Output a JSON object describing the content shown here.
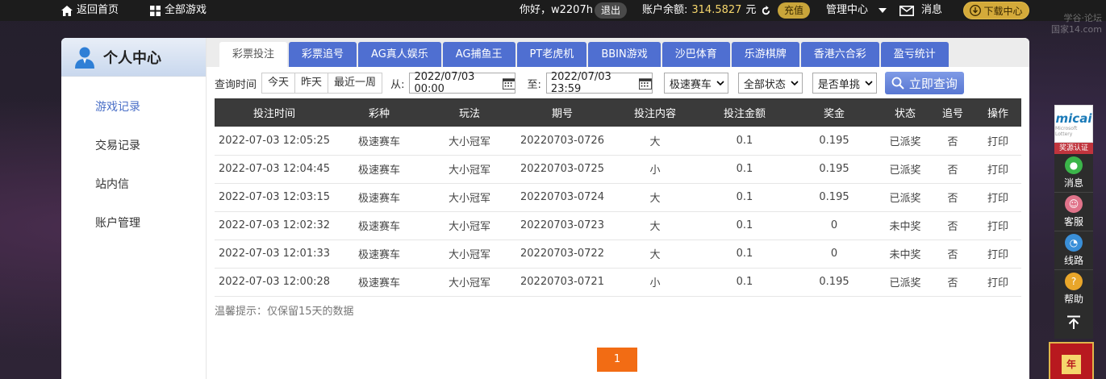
{
  "topbar": {
    "home": "返回首页",
    "all_games": "全部游戏",
    "greeting": "你好，w2207h",
    "logout": "退出",
    "balance_label": "账户余额:",
    "balance_value": "314.5827",
    "currency": "元",
    "recharge": "充值",
    "management": "管理中心",
    "messages": "消息",
    "download": "下载中心"
  },
  "watermark": {
    "line1": "学谷·论坛",
    "line2": "国家14.com"
  },
  "sidebar": {
    "title": "个人中心",
    "items": [
      {
        "label": "游戏记录",
        "active": true
      },
      {
        "label": "交易记录",
        "active": false
      },
      {
        "label": "站内信",
        "active": false
      },
      {
        "label": "账户管理",
        "active": false
      }
    ]
  },
  "tabs": [
    {
      "label": "彩票投注",
      "active": true
    },
    {
      "label": "彩票追号",
      "active": false
    },
    {
      "label": "AG真人娱乐",
      "active": false
    },
    {
      "label": "AG捕鱼王",
      "active": false
    },
    {
      "label": "PT老虎机",
      "active": false
    },
    {
      "label": "BBIN游戏",
      "active": false
    },
    {
      "label": "沙巴体育",
      "active": false
    },
    {
      "label": "乐游棋牌",
      "active": false
    },
    {
      "label": "香港六合彩",
      "active": false
    },
    {
      "label": "盈亏统计",
      "active": false
    }
  ],
  "filter": {
    "query_time_label": "查询时间",
    "quick": [
      "今天",
      "昨天",
      "最近一周"
    ],
    "from_label": "从:",
    "from_value": "2022/07/03 00:00",
    "to_label": "至:",
    "to_value": "2022/07/03 23:59",
    "game_select": "极速赛车",
    "status_select": "全部状态",
    "single_select": "是否单挑",
    "query_button": "立即查询"
  },
  "table": {
    "headers": [
      "投注时间",
      "彩种",
      "玩法",
      "期号",
      "投注内容",
      "投注金额",
      "奖金",
      "状态",
      "追号",
      "操作"
    ],
    "rows": [
      {
        "time": "2022-07-03 12:05:25",
        "game": "极速赛车",
        "play": "大小冠军",
        "period": "20220703-0726",
        "content": "大",
        "amount": "0.1",
        "prize": "0.195",
        "status": "已派奖",
        "chase": "否",
        "action": "打印",
        "won": true
      },
      {
        "time": "2022-07-03 12:04:45",
        "game": "极速赛车",
        "play": "大小冠军",
        "period": "20220703-0725",
        "content": "小",
        "amount": "0.1",
        "prize": "0.195",
        "status": "已派奖",
        "chase": "否",
        "action": "打印",
        "won": true
      },
      {
        "time": "2022-07-03 12:03:15",
        "game": "极速赛车",
        "play": "大小冠军",
        "period": "20220703-0724",
        "content": "大",
        "amount": "0.1",
        "prize": "0.195",
        "status": "已派奖",
        "chase": "否",
        "action": "打印",
        "won": true
      },
      {
        "time": "2022-07-03 12:02:32",
        "game": "极速赛车",
        "play": "大小冠军",
        "period": "20220703-0723",
        "content": "大",
        "amount": "0.1",
        "prize": "0",
        "status": "未中奖",
        "chase": "否",
        "action": "打印",
        "won": false
      },
      {
        "time": "2022-07-03 12:01:33",
        "game": "极速赛车",
        "play": "大小冠军",
        "period": "20220703-0722",
        "content": "大",
        "amount": "0.1",
        "prize": "0",
        "status": "未中奖",
        "chase": "否",
        "action": "打印",
        "won": false
      },
      {
        "time": "2022-07-03 12:00:28",
        "game": "极速赛车",
        "play": "大小冠军",
        "period": "20220703-0721",
        "content": "小",
        "amount": "0.1",
        "prize": "0.195",
        "status": "已派奖",
        "chase": "否",
        "action": "打印",
        "won": true
      }
    ]
  },
  "tip": "温馨提示：仅保留15天的数据",
  "pagination": {
    "current": "1"
  },
  "float_bar": {
    "logo": "micai",
    "logo_sub": "Microsoft Lottery",
    "badge": "奖源认证",
    "items": [
      {
        "label": "消息",
        "icon": "chat-icon",
        "color": "#3bb54a"
      },
      {
        "label": "客服",
        "icon": "customer-service-icon",
        "color": "#e0738a"
      },
      {
        "label": "线路",
        "icon": "speedometer-icon",
        "color": "#3a8fd8"
      },
      {
        "label": "帮助",
        "icon": "help-icon",
        "color": "#e9a62a"
      }
    ]
  },
  "lantern": "年"
}
